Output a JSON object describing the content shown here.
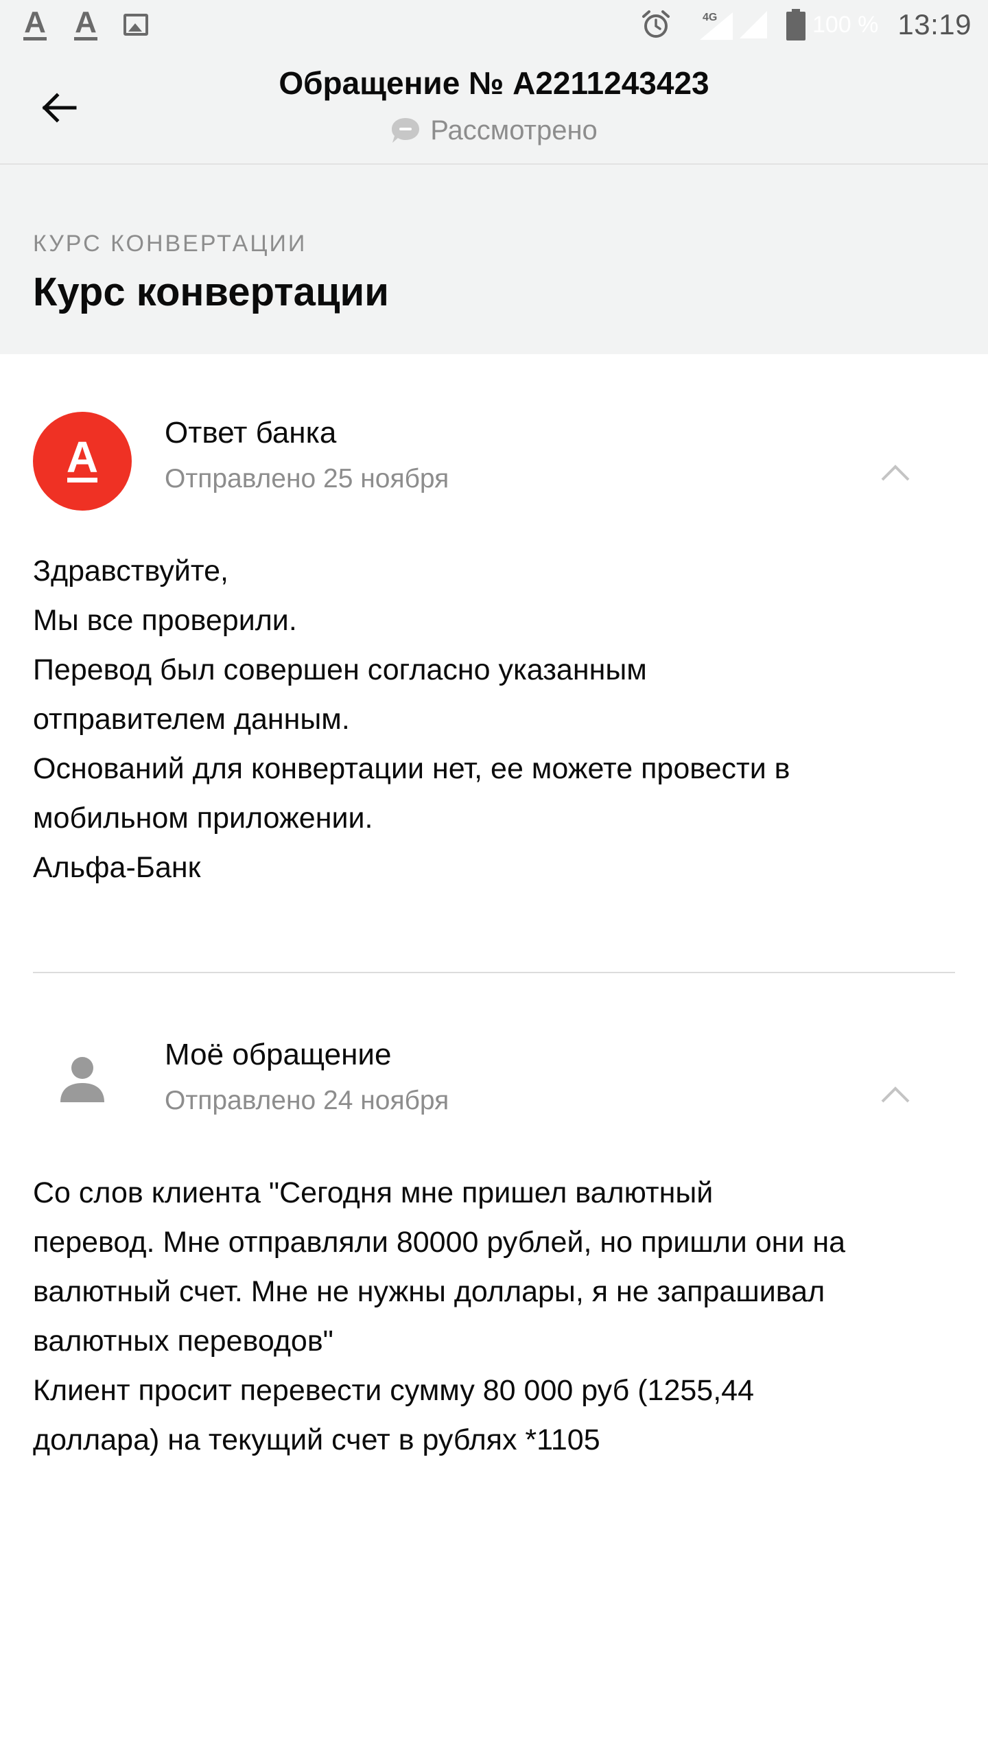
{
  "status_bar": {
    "left_icons": [
      "font-a-icon",
      "font-a-icon",
      "image-icon"
    ],
    "network": "4G",
    "battery_percent": "100 %",
    "time": "13:19"
  },
  "toolbar": {
    "title": "Обращение № A2211243423",
    "status": "Рассмотрено"
  },
  "category": {
    "label": "КУРС КОНВЕРТАЦИИ",
    "title": "Курс конвертации"
  },
  "messages": [
    {
      "author": "Ответ банка",
      "date": "Отправлено 25 ноября",
      "avatar_letter": "А",
      "lines": [
        "Здравствуйте,",
        "Мы все проверили.",
        "Перевод был совершен согласно указанным",
        "отправителем данным.",
        "Оснований для конвертации нет, ее можете провести в",
        "мобильном приложении.",
        "Альфа-Банк"
      ]
    },
    {
      "author": "Моё обращение",
      "date": "Отправлено 24 ноября",
      "lines": [
        "Со слов клиента \"Сегодня мне пришел валютный",
        "перевод. Мне отправляли 80000 рублей, но пришли они на",
        "валютный счет. Мне не нужны доллары, я не запрашивал",
        "валютных переводов\"",
        "Клиент просит перевести сумму 80 000 руб (1255,44",
        "доллара) на текущий счет в рублях *1105"
      ]
    }
  ],
  "colors": {
    "brand_red": "#ef3124",
    "header_bg": "#f2f3f3",
    "secondary_text": "#8d8d8d"
  }
}
